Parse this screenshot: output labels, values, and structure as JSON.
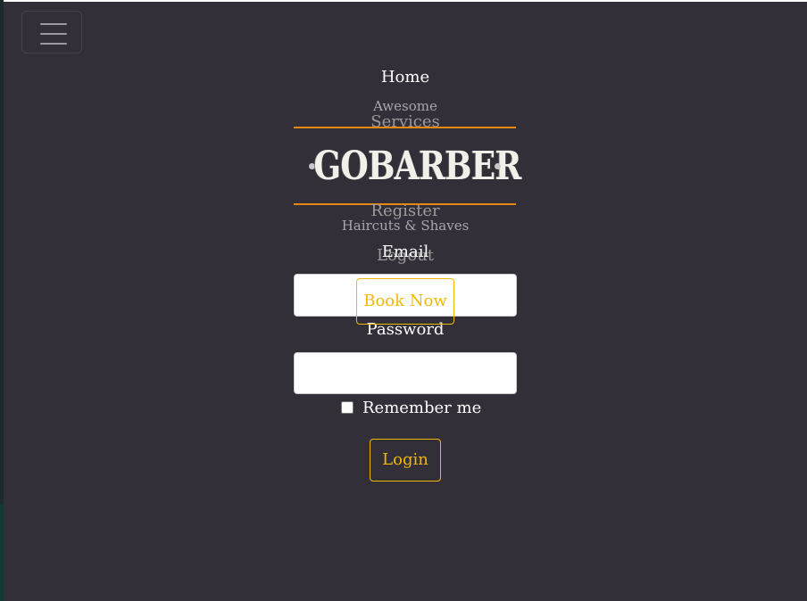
{
  "nav": {
    "toggle_icon": "hamburger-menu-icon",
    "links": [
      {
        "label": "Home"
      },
      {
        "label": "Services"
      },
      {
        "label": "Register"
      },
      {
        "label": "Logout"
      }
    ]
  },
  "hero": {
    "tagline_top": "Awesome",
    "brand": "GOBARBER",
    "tagline_bottom": "Haircuts & Shaves",
    "book_label": "Book Now",
    "accent_color": "#e48812",
    "button_color": "#f2b705"
  },
  "form": {
    "email_label": "Email",
    "email_value": "",
    "password_label": "Password",
    "password_value": "",
    "remember_label": "Remember me",
    "remember_checked": false,
    "login_label": "Login"
  },
  "theme": {
    "background": "#322f38"
  }
}
